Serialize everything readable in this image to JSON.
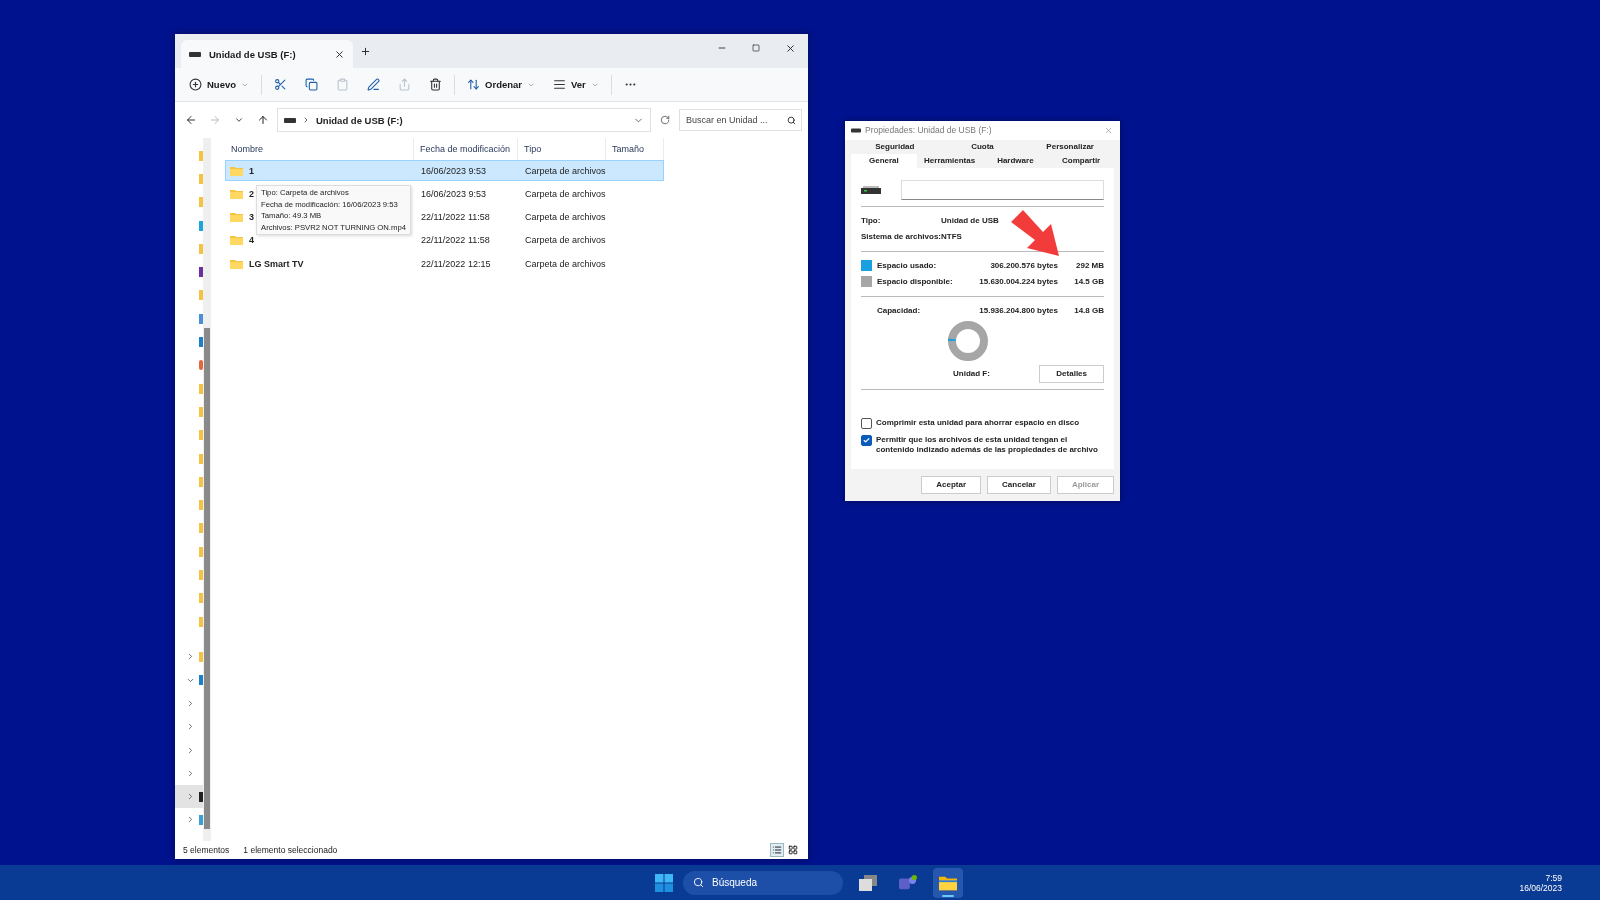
{
  "explorer": {
    "tab": {
      "title": "Unidad de USB (F:)"
    },
    "toolbar": [
      {
        "kind": "new",
        "label": "Nuevo",
        "disabled": false
      },
      {
        "kind": "cut",
        "disabled": false
      },
      {
        "kind": "copy",
        "disabled": false
      },
      {
        "kind": "paste",
        "disabled": true
      },
      {
        "kind": "rename",
        "disabled": false
      },
      {
        "kind": "share",
        "disabled": true
      },
      {
        "kind": "delete",
        "disabled": false
      },
      {
        "kind": "sort",
        "label": "Ordenar",
        "disabled": false
      },
      {
        "kind": "view",
        "label": "Ver",
        "disabled": false
      },
      {
        "kind": "more",
        "disabled": false
      }
    ],
    "nav": {
      "back_disabled": false,
      "forward_disabled": true
    },
    "address": {
      "path": "Unidad de USB (F:)"
    },
    "search": {
      "placeholder": "Buscar en Unidad ..."
    },
    "nav_items": [
      {
        "kind": "folder"
      },
      {
        "kind": "folder"
      },
      {
        "kind": "folder"
      },
      {
        "kind": "app"
      },
      {
        "kind": "folder"
      },
      {
        "kind": "media"
      },
      {
        "kind": "folder"
      },
      {
        "kind": "doc"
      },
      {
        "kind": "drive"
      },
      {
        "kind": "round"
      },
      {
        "kind": "folder"
      },
      {
        "kind": "folder"
      },
      {
        "kind": "folder"
      },
      {
        "kind": "folder"
      },
      {
        "kind": "folder"
      },
      {
        "kind": "folder"
      },
      {
        "kind": "folder"
      },
      {
        "kind": "folder"
      },
      {
        "kind": "folder"
      },
      {
        "kind": "folder"
      },
      {
        "kind": "folder"
      }
    ],
    "tree_items": [
      {
        "kind": "folder",
        "expanded": false
      },
      {
        "kind": "drive",
        "expanded": true
      },
      {
        "kind": "none",
        "expanded": false
      },
      {
        "kind": "none",
        "expanded": false
      },
      {
        "kind": "none",
        "expanded": false
      },
      {
        "kind": "none",
        "expanded": false
      },
      {
        "kind": "usb",
        "expanded": false,
        "selected": true
      },
      {
        "kind": "network",
        "expanded": false
      }
    ],
    "columns": [
      "Nombre",
      "Fecha de modificación",
      "Tipo",
      "Tamaño"
    ],
    "rows": [
      {
        "name": "1",
        "date": "16/06/2023 9:53",
        "type": "Carpeta de archivos",
        "selected": true
      },
      {
        "name": "2",
        "date": "16/06/2023 9:53",
        "type": "Carpeta de archivos",
        "selected": false
      },
      {
        "name": "3",
        "date": "22/11/2022 11:58",
        "type": "Carpeta de archivos",
        "selected": false
      },
      {
        "name": "4",
        "date": "22/11/2022 11:58",
        "type": "Carpeta de archivos",
        "selected": false
      },
      {
        "name": "LG Smart TV",
        "date": "22/11/2022 12:15",
        "type": "Carpeta de archivos",
        "selected": false
      }
    ],
    "tooltip": [
      "Tipo: Carpeta de archivos",
      "Fecha de modificación: 16/06/2023 9:53",
      "Tamaño: 49.3 MB",
      "Archivos: PSVR2 NOT TURNING ON.mp4"
    ],
    "status_bar": {
      "count": "5 elementos",
      "selection": "1 elemento seleccionado",
      "view_details": true
    }
  },
  "properties": {
    "title": "Propiedades: Unidad de USB (F:)",
    "tab_rows": [
      [
        {
          "label": "Seguridad",
          "selected": false
        },
        {
          "label": "Cuota",
          "selected": false
        },
        {
          "label": "Personalizar",
          "selected": false
        }
      ],
      [
        {
          "label": "General",
          "selected": true
        },
        {
          "label": "Herramientas",
          "selected": false
        },
        {
          "label": "Hardware",
          "selected": false
        },
        {
          "label": "Compartir",
          "selected": false
        }
      ]
    ],
    "info": [
      {
        "label": "Tipo:",
        "value": "Unidad de USB"
      },
      {
        "label": "Sistema de archivos:",
        "value": "NTFS"
      }
    ],
    "space": [
      {
        "label": "Espacio usado:",
        "bytes": "306.200.576 bytes",
        "size": "292 MB",
        "color": "#1a9fe0"
      },
      {
        "label": "Espacio disponible:",
        "bytes": "15.630.004.224 bytes",
        "size": "14.5 GB",
        "color": "#a6a6a6"
      }
    ],
    "capacity": {
      "label": "Capacidad:",
      "bytes": "15.936.204.800 bytes",
      "size": "14.8 GB"
    },
    "usage": {
      "level": 0.02
    },
    "drive_label": "Unidad F:",
    "details_button": "Detalles",
    "options": [
      {
        "label": "Comprimir esta unidad para ahorrar espacio en disco",
        "checked": false
      },
      {
        "label": "Permitir que los archivos de esta unidad tengan el contenido indizado además de las propiedades de archivo",
        "checked": true
      }
    ],
    "buttons": [
      {
        "label": "Aceptar",
        "disabled": false
      },
      {
        "label": "Cancelar",
        "disabled": false
      },
      {
        "label": "Aplicar",
        "disabled": true
      }
    ]
  },
  "taskbar": {
    "search": "Búsqueda",
    "apps": [
      {
        "kind": "taskview",
        "active": false
      },
      {
        "kind": "teams",
        "active": false
      },
      {
        "kind": "explorer",
        "active": true
      }
    ],
    "time": "7:59",
    "date": "16/06/2023"
  }
}
